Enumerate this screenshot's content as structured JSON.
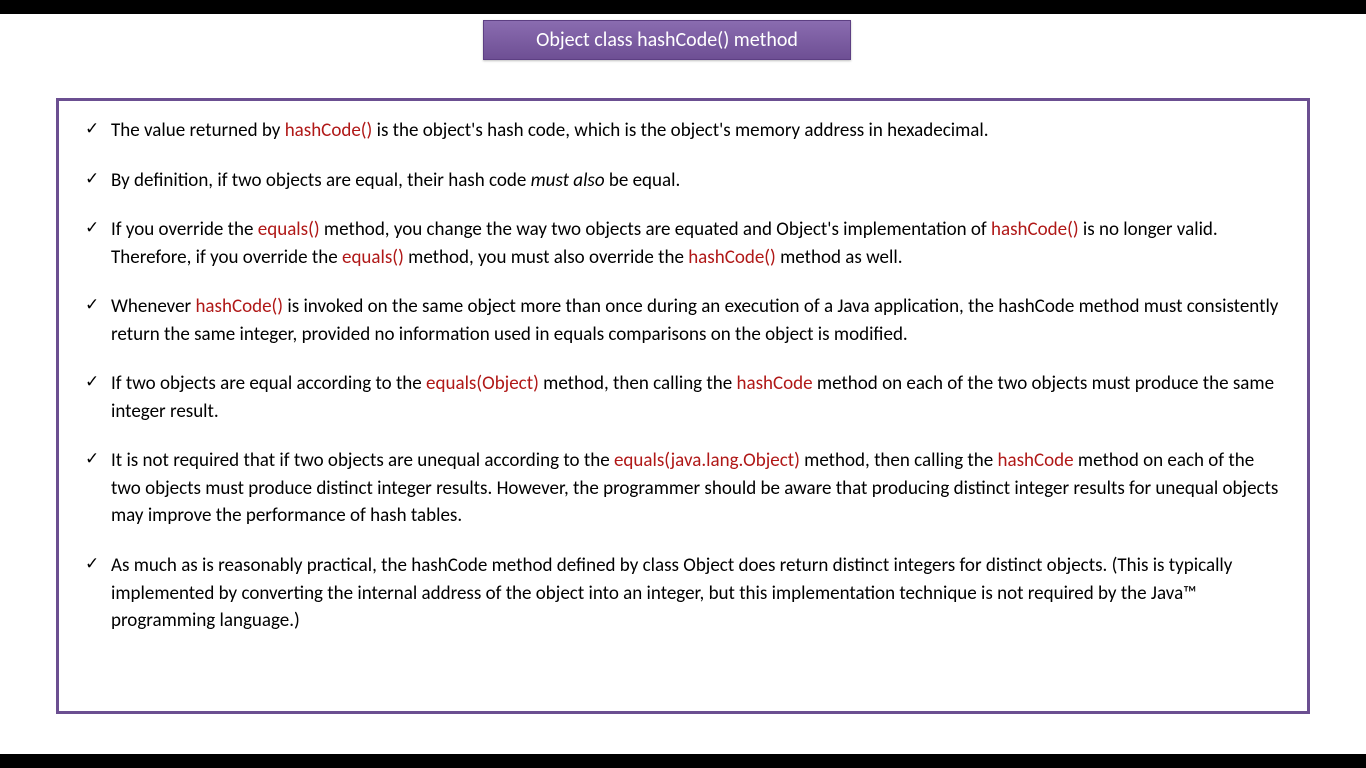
{
  "title": "Object class hashCode() method",
  "kw": {
    "hashCodeP": "hashCode()",
    "equalsP": "equals()",
    "equalsObj": "equals(Object)",
    "hashCode": "hashCode",
    "equalsJLO": "equals(java.lang.Object)"
  },
  "b1": {
    "t1": "The value returned by ",
    "t2": " is the object's hash code, which is the object's memory address in hexadecimal."
  },
  "b2": {
    "t1": "By definition, if two objects are equal, their hash code ",
    "it": "must also",
    "t2": " be equal."
  },
  "b3": {
    "t1": "If you override the ",
    "t2": " method, you change the way two objects are equated and Object's implementation of ",
    "t3": " is no longer valid. Therefore, if you override the ",
    "t4": " method, you must also override the ",
    "t5": " method as well."
  },
  "b4": {
    "t1": "Whenever ",
    "t2": " is invoked on the same object more than once during an execution of a Java application, the hashCode method must consistently return the same integer, provided no information used in equals comparisons on the object is modified."
  },
  "b5": {
    "t1": "If two objects are equal according to the ",
    "t2": " method, then calling the ",
    "t3": " method on each of the two objects must produce the same integer result."
  },
  "b6": {
    "t1": "It is not required that if two objects are unequal according to the ",
    "t2": " method, then calling the ",
    "t3": " method on each of the two objects must produce distinct integer results. However, the programmer should be aware that producing distinct integer results for unequal objects may improve the performance of hash tables."
  },
  "b7": {
    "t1": "As much as is reasonably practical, the hashCode method defined by class Object does return distinct integers for distinct objects. (This is typically implemented by converting the internal address of the object into an integer, but this implementation technique is not required by the Java™ programming language.)"
  }
}
